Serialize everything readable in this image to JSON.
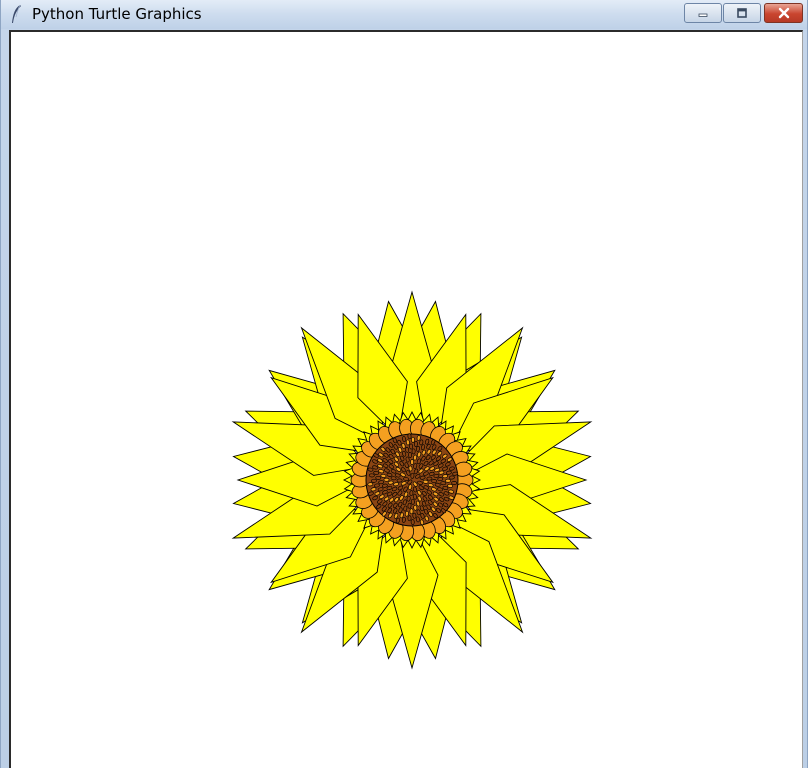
{
  "window": {
    "title": "Python Turtle Graphics",
    "app_icon": "feather-icon",
    "controls": {
      "minimize_icon": "minimize-icon",
      "maximize_icon": "maximize-icon",
      "close_icon": "close-icon"
    }
  },
  "colors": {
    "petal_fill": "#ffff00",
    "outline": "#000000",
    "seed_fill": "#f4a020",
    "center_fill": "#8b4513",
    "canvas_bg": "#ffffff"
  },
  "drawing": {
    "subject": "sunflower",
    "petal_ring_outer_count": 24,
    "petal_ring_inner_count": 20,
    "seed_ring_count": 30
  }
}
